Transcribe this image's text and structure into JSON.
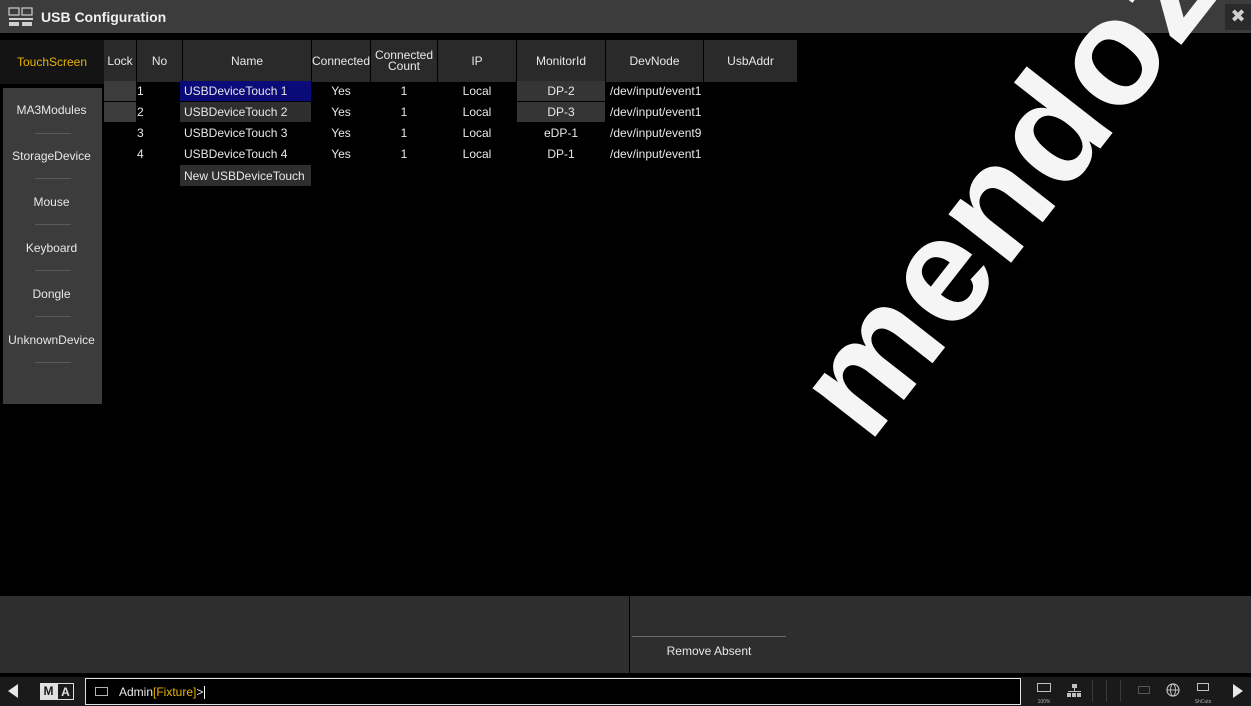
{
  "window": {
    "title": "USB Configuration",
    "close_glyph": "✖"
  },
  "sidebar": {
    "active_tab": "TouchScreen",
    "tabs": [
      "MA3Modules",
      "StorageDevice",
      "Mouse",
      "Keyboard",
      "Dongle",
      "UnknownDevice"
    ]
  },
  "table": {
    "headers": [
      "Lock",
      "No",
      "Name",
      "Connected",
      "Connected Count",
      "IP",
      "MonitorId",
      "DevNode",
      "UsbAddr"
    ],
    "rows": [
      {
        "lock": "",
        "no": "1",
        "name": "USBDeviceTouch 1",
        "connected": "Yes",
        "count": "1",
        "ip": "Local",
        "monitor": "DP-2",
        "devnode": "/dev/input/event1",
        "usbaddr": ""
      },
      {
        "lock": "",
        "no": "2",
        "name": "USBDeviceTouch 2",
        "connected": "Yes",
        "count": "1",
        "ip": "Local",
        "monitor": "DP-3",
        "devnode": "/dev/input/event1",
        "usbaddr": ""
      },
      {
        "lock": "",
        "no": "3",
        "name": "USBDeviceTouch 3",
        "connected": "Yes",
        "count": "1",
        "ip": "Local",
        "monitor": "eDP-1",
        "devnode": "/dev/input/event9",
        "usbaddr": ""
      },
      {
        "lock": "",
        "no": "4",
        "name": "USBDeviceTouch 4",
        "connected": "Yes",
        "count": "1",
        "ip": "Local",
        "monitor": "DP-1",
        "devnode": "/dev/input/event1",
        "usbaddr": ""
      }
    ],
    "new_row_label": "New USBDeviceTouch"
  },
  "actions": {
    "remove_absent": "Remove Absent"
  },
  "commandline": {
    "user": "Admin",
    "context": "[Fixture]",
    "prompt": ">"
  },
  "status_icons": {
    "zoom": "100%",
    "shortcuts": "ShCuts"
  },
  "logo": {
    "m": "M",
    "a": "A"
  },
  "watermark": "mendoza.com",
  "colors": {
    "accent": "#e8b400",
    "selected_row": "#0a0a78",
    "panel": "#3c3c3c"
  }
}
